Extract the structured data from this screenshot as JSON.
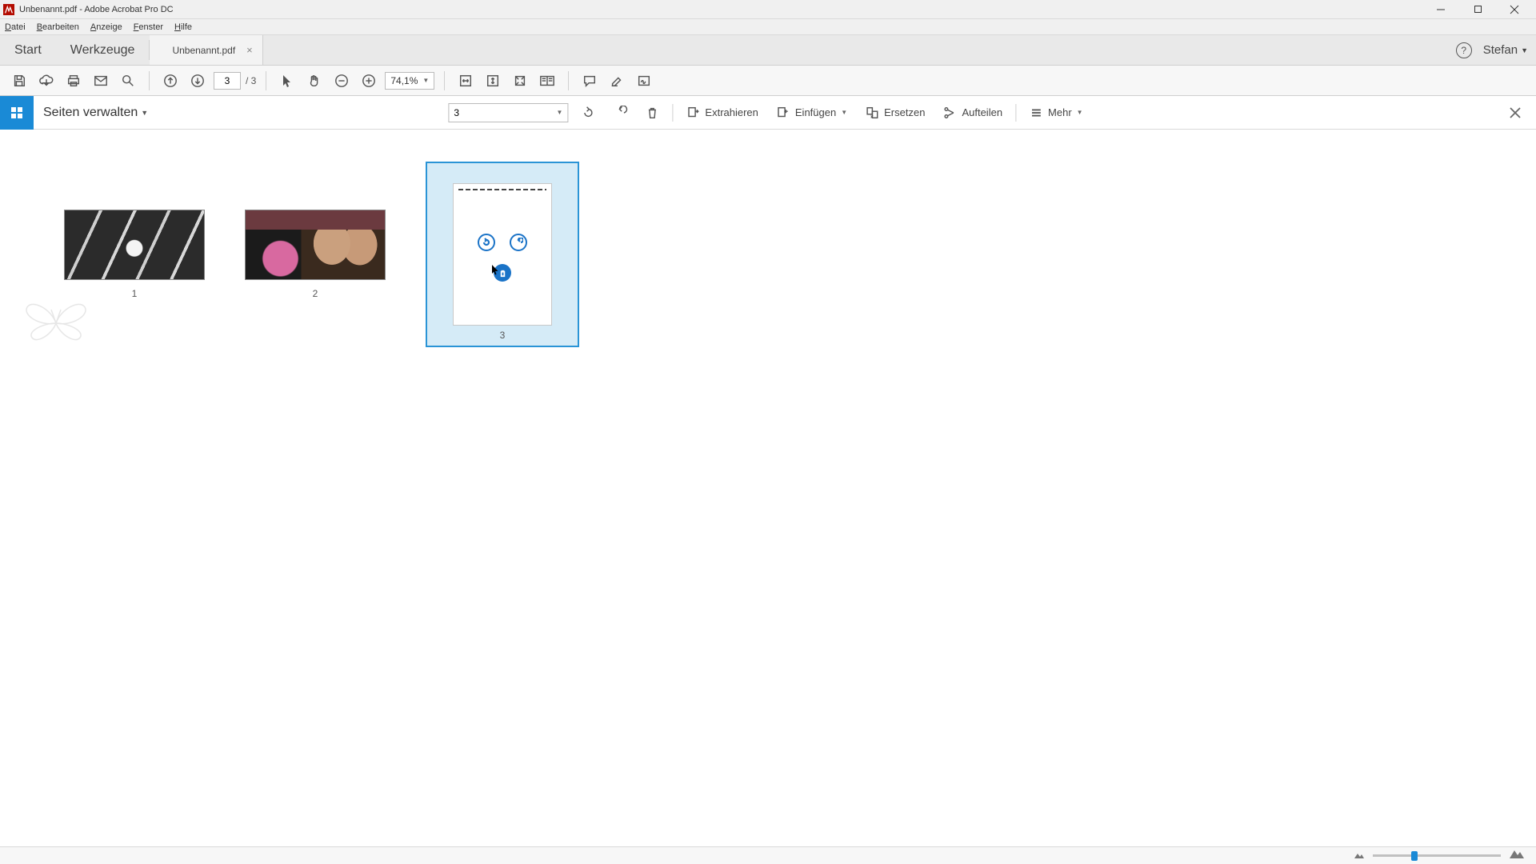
{
  "window": {
    "title": "Unbenannt.pdf - Adobe Acrobat Pro DC"
  },
  "menu": {
    "file": "Datei",
    "edit": "Bearbeiten",
    "view": "Anzeige",
    "window": "Fenster",
    "help": "Hilfe"
  },
  "tabs": {
    "start": "Start",
    "tools": "Werkzeuge",
    "document": "Unbenannt.pdf"
  },
  "header_right": {
    "user": "Stefan"
  },
  "toolbar": {
    "page_current": "3",
    "page_total": "/ 3",
    "zoom": "74,1%"
  },
  "organize": {
    "title": "Seiten verwalten",
    "page_field": "3",
    "extract": "Extrahieren",
    "insert": "Einfügen",
    "replace": "Ersetzen",
    "split": "Aufteilen",
    "more": "Mehr"
  },
  "thumbnails": {
    "items": [
      {
        "num": "1",
        "orientation": "landscape",
        "selected": false
      },
      {
        "num": "2",
        "orientation": "landscape",
        "selected": false
      },
      {
        "num": "3",
        "orientation": "portrait",
        "selected": true
      }
    ]
  },
  "bottombar": {
    "slider_pct": 30
  }
}
